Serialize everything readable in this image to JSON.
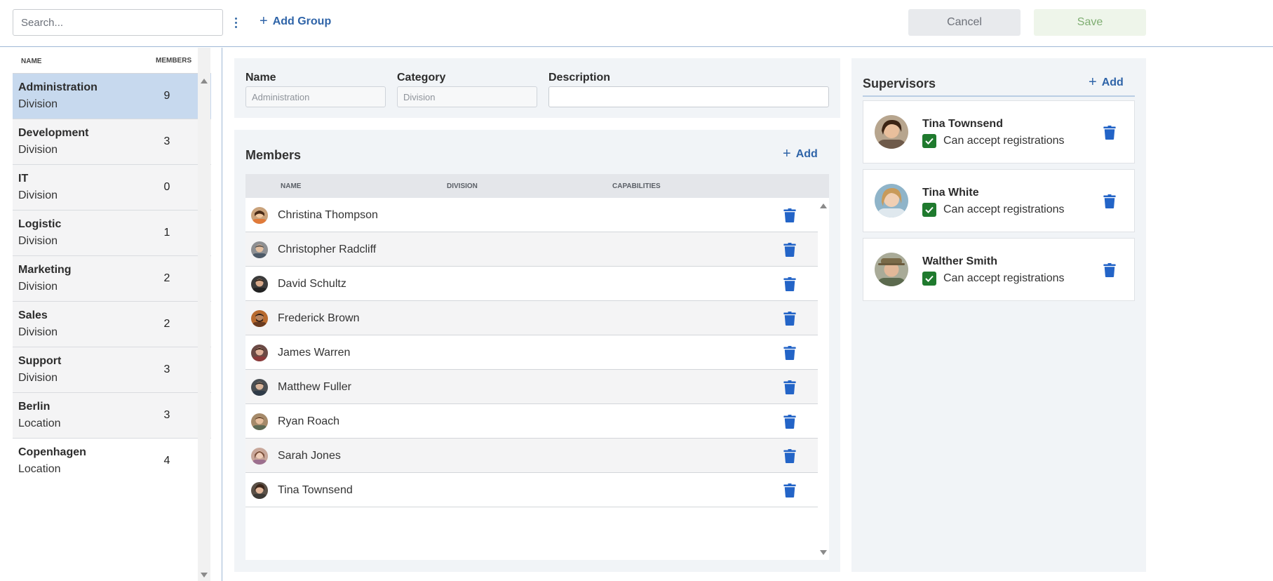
{
  "toolbar": {
    "search_placeholder": "Search...",
    "add_group_label": "Add Group",
    "cancel_label": "Cancel",
    "save_label": "Save"
  },
  "groups": {
    "header_name": "NAME",
    "header_members": "MEMBERS",
    "items": [
      {
        "name": "Administration",
        "category": "Division",
        "members": "9",
        "selected": true
      },
      {
        "name": "Development",
        "category": "Division",
        "members": "3"
      },
      {
        "name": "IT",
        "category": "Division",
        "members": "0"
      },
      {
        "name": "Logistic",
        "category": "Division",
        "members": "1"
      },
      {
        "name": "Marketing",
        "category": "Division",
        "members": "2"
      },
      {
        "name": "Sales",
        "category": "Division",
        "members": "2"
      },
      {
        "name": "Support",
        "category": "Division",
        "members": "3"
      },
      {
        "name": "Berlin",
        "category": "Location",
        "members": "3"
      },
      {
        "name": "Copenhagen",
        "category": "Location",
        "members": "4"
      }
    ]
  },
  "details": {
    "name_label": "Name",
    "name_value": "Administration",
    "category_label": "Category",
    "category_value": "Division",
    "description_label": "Description",
    "description_value": ""
  },
  "members": {
    "title": "Members",
    "add_label": "Add",
    "col_name": "NAME",
    "col_division": "DIVISION",
    "col_capabilities": "CAPABILITIES",
    "rows": [
      {
        "name": "Christina Thompson"
      },
      {
        "name": "Christopher Radcliff"
      },
      {
        "name": "David Schultz"
      },
      {
        "name": "Frederick Brown"
      },
      {
        "name": "James Warren"
      },
      {
        "name": "Matthew Fuller"
      },
      {
        "name": "Ryan Roach"
      },
      {
        "name": "Sarah Jones"
      },
      {
        "name": "Tina Townsend"
      }
    ]
  },
  "supervisors": {
    "title": "Supervisors",
    "add_label": "Add",
    "items": [
      {
        "name": "Tina Townsend",
        "capability": "Can accept registrations",
        "checked": true
      },
      {
        "name": "Tina White",
        "capability": "Can accept registrations",
        "checked": true
      },
      {
        "name": "Walther Smith",
        "capability": "Can accept registrations",
        "checked": true
      }
    ]
  },
  "colors": {
    "accent": "#2f64a8",
    "selected_row": "#c7d9ee",
    "checkbox": "#1f7a2e",
    "delete_icon": "#2364c7"
  },
  "icons": {
    "add": "plus-icon",
    "delete": "trash-icon",
    "more": "kebab-menu-icon",
    "check": "checkmark-icon"
  }
}
